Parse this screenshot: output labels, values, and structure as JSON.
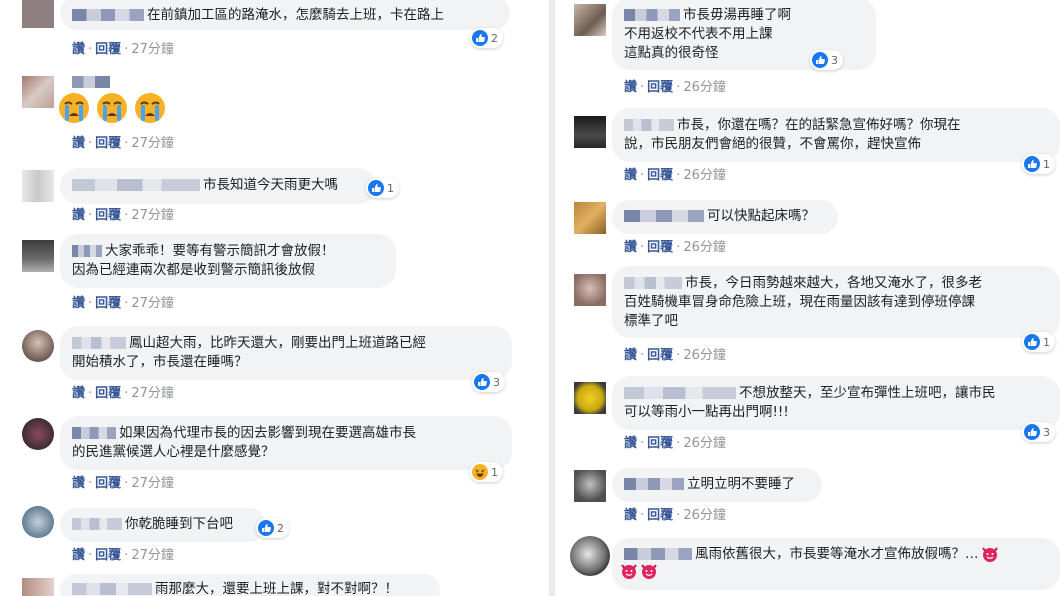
{
  "actions": {
    "like": "讚",
    "reply": "回覆",
    "sep": "·"
  },
  "left": [
    {
      "text": "在前鎮加工區的路淹水，怎麼騎去上班，卡在路上",
      "time": "27分鐘",
      "reactions": "2"
    },
    {
      "text": "",
      "time": "27分鐘",
      "reactions": ""
    },
    {
      "text": "市長知道今天雨更大嗎",
      "time": "27分鐘",
      "reactions": "1"
    },
    {
      "line1": "大家乖乖！要等有警示簡訊才會放假！",
      "line2": "因為已經連兩次都是收到警示簡訊後放假",
      "time": "27分鐘"
    },
    {
      "line1": "鳳山超大雨，比昨天還大，剛要出門上班道路已經",
      "line2": "開始積水了，市長還在睡嗎？",
      "time": "27分鐘",
      "reactions": "3"
    },
    {
      "line1": "如果因為代理市長的因去影響到現在要選高雄市長",
      "line2": "的民進黨候選人心裡是什麼感覺？",
      "time": "27分鐘",
      "reactions": "1"
    },
    {
      "text": "你乾脆睡到下台吧",
      "time": "27分鐘",
      "reactions": "2"
    },
    {
      "text": "雨那麼大，還要上班上課，對不對啊？！"
    }
  ],
  "right": [
    {
      "line1": "市長毋湯再睡了啊",
      "line2": "不用返校不代表不用上課",
      "line3": "這點真的很奇怪",
      "time": "26分鐘",
      "reactions": "3"
    },
    {
      "line1": "市長，你還在嗎？在的話緊急宣佈好嗎？你現在",
      "line2": "說，市民朋友們會絕的很贊，不會罵你，趕快宣佈",
      "time": "26分鐘",
      "reactions": "1"
    },
    {
      "text": "可以快點起床嗎？",
      "time": "26分鐘"
    },
    {
      "line1": "市長，今日雨勢越來越大，各地又淹水了，很多老",
      "line2": "百姓騎機車冒身命危險上班，現在雨量因該有達到停班停課",
      "line3": "標準了吧",
      "time": "26分鐘",
      "reactions": "1"
    },
    {
      "line1": "不想放整天，至少宣布彈性上班吧，讓市民",
      "line2": "可以等雨小一點再出門啊!!!",
      "time": "26分鐘",
      "reactions": "3"
    },
    {
      "text": "立明立明不要睡了",
      "time": "26分鐘"
    },
    {
      "text": "風雨依舊很大，市長要等淹水才宣佈放假嗎？…"
    }
  ]
}
